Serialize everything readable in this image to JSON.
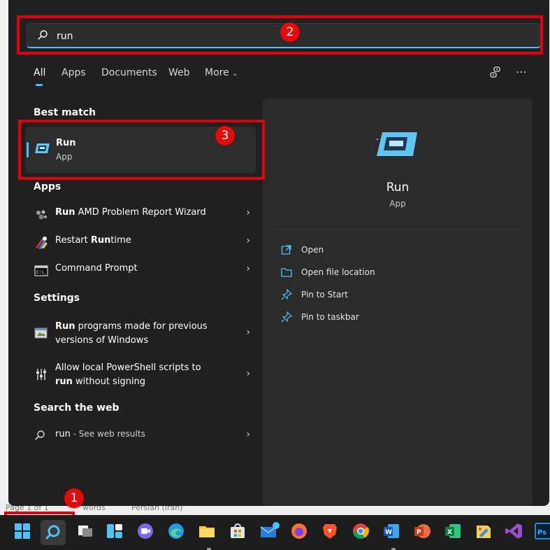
{
  "background": {
    "status_bar": [
      "Page 1 of 1",
      "words",
      "Persian (Iran)"
    ]
  },
  "search": {
    "query": "run",
    "placeholder": ""
  },
  "tabs": [
    "All",
    "Apps",
    "Documents",
    "Web",
    "More"
  ],
  "best_match": {
    "section_title": "Best match",
    "name": "Run",
    "type": "App"
  },
  "apps": {
    "section_title": "Apps",
    "items": [
      {
        "bold": "Run",
        "rest": " AMD Problem Report Wizard",
        "icon": "amd-report-icon"
      },
      {
        "bold_prefix": "Restart ",
        "bold": "Run",
        "rest": "time",
        "icon": "restart-runtime-icon"
      },
      {
        "label": "Command Prompt",
        "icon": "command-prompt-icon"
      }
    ]
  },
  "settings": {
    "section_title": "Settings",
    "items": [
      {
        "line1_bold": "Run",
        "line1_rest": " programs made for previous",
        "line2": "versions of Windows",
        "icon": "compatibility-icon"
      },
      {
        "line1": "Allow local PowerShell scripts to",
        "line2_bold": "run",
        "line2_rest": " without signing",
        "icon": "powershell-settings-icon"
      }
    ]
  },
  "web": {
    "section_title": "Search the web",
    "query": "run",
    "suffix": " - See web results"
  },
  "detail": {
    "name": "Run",
    "type": "App",
    "actions": [
      {
        "label": "Open",
        "icon": "open-external-icon"
      },
      {
        "label": "Open file location",
        "icon": "folder-icon"
      },
      {
        "label": "Pin to Start",
        "icon": "pin-icon"
      },
      {
        "label": "Pin to taskbar",
        "icon": "pin-icon"
      }
    ]
  },
  "annotations": [
    "1",
    "2",
    "3"
  ],
  "taskbar": {
    "items": [
      "start-icon",
      "search-icon",
      "task-view-icon",
      "widgets-icon",
      "teams-chat-icon",
      "edge-icon",
      "file-explorer-icon",
      "store-icon",
      "mail-icon",
      "firefox-icon",
      "brave-icon",
      "chrome-icon",
      "word-icon",
      "powerpoint-icon",
      "excel-icon",
      "paint-icon",
      "visual-studio-icon",
      "photoshop-icon"
    ]
  },
  "colors": {
    "accent": "#4cc2ff",
    "panel_bg": "#202020",
    "annotation_red": "#e0000d"
  }
}
